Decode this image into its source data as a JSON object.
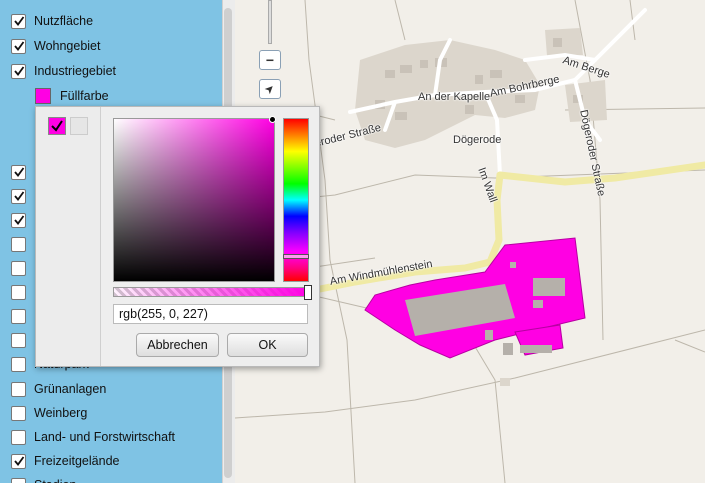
{
  "colors": {
    "sidebar_bg": "#7fc3e4",
    "selected_fill": "#ff00e3",
    "map_bg": "#f2efe9"
  },
  "sidebar": {
    "layers_top": [
      {
        "label": "Nutzfläche",
        "checked": true
      },
      {
        "label": "Wohngebiet",
        "checked": true
      },
      {
        "label": "Industriegebiet",
        "checked": true
      }
    ],
    "fill_color_label": "Füllfarbe",
    "layers_hidden": [
      {
        "checked": true
      },
      {
        "checked": true
      },
      {
        "checked": true
      },
      {
        "checked": false
      },
      {
        "checked": false
      },
      {
        "checked": false
      },
      {
        "checked": false
      },
      {
        "checked": false
      }
    ],
    "layers_bottom": [
      {
        "label": "Naturpark",
        "checked": false
      },
      {
        "label": "Grünanlagen",
        "checked": false
      },
      {
        "label": "Weinberg",
        "checked": false
      },
      {
        "label": "Land- und Forstwirtschaft",
        "checked": false
      },
      {
        "label": "Freizeitgelände",
        "checked": true
      },
      {
        "label": "Stadion",
        "checked": false
      }
    ]
  },
  "color_picker": {
    "value": "rgb(255, 0, 227)",
    "cancel_label": "Abbrechen",
    "ok_label": "OK",
    "palette": [
      "#ff00e3",
      "#e6e6e6"
    ]
  },
  "map": {
    "labels": {
      "am_berge": "Am Berge",
      "an_der_kapelle": "An der Kapelle",
      "am_bohrberge": "Am Bohrberge",
      "dogerode": "Dögerode",
      "dogeroder_strasse_left": "eroder Straße",
      "dogeroder_strasse_right": "Dögeroder Straße",
      "im_wall": "Im Wall",
      "am_windmuhlenstein": "Am Windmühlenstein"
    },
    "zoom_out": "−",
    "locate_icon": "➤"
  }
}
